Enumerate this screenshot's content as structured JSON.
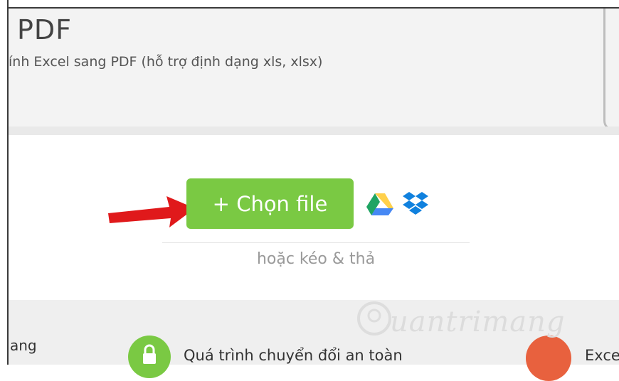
{
  "header": {
    "title": "PDF",
    "subtitle": "ính Excel sang PDF (hỗ trợ định dạng xls, xlsx)"
  },
  "upload": {
    "choose_file_label": "+ Chọn file",
    "drag_drop_hint": "hoặc kéo & thả",
    "cloud_icons": [
      "google-drive-icon",
      "dropbox-icon"
    ]
  },
  "features": {
    "left_text": "ang",
    "secure_text": "Quá trình chuyển đổi an toàn",
    "right_text": "Exce"
  },
  "watermark": {
    "text": "uantrimang"
  },
  "colors": {
    "accent_green": "#7ac943",
    "arrow_red": "#e0191b",
    "thumb_orange": "#e8613e",
    "google_drive": [
      "#1fa463",
      "#ffd04b",
      "#4688f4"
    ],
    "dropbox_blue": "#1081de"
  }
}
